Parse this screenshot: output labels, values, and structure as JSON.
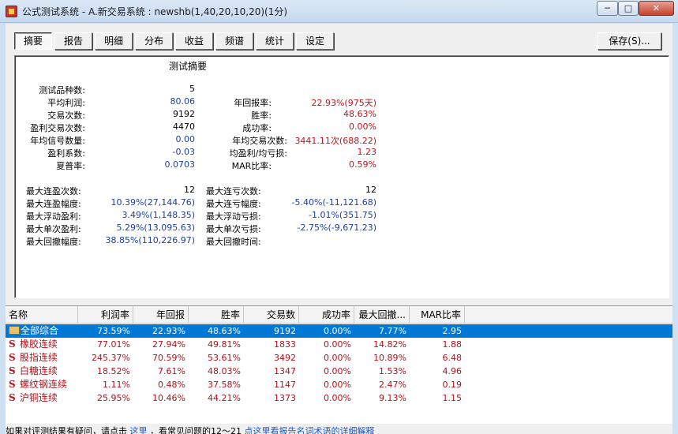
{
  "window": {
    "title": "公式测试系统 - A.新交易系统 : newshb(1,40,20,10,20)(1分)",
    "min_label": "─",
    "max_label": "□",
    "close_label": "✕"
  },
  "tabs": [
    "摘要",
    "报告",
    "明细",
    "分布",
    "收益",
    "频谱",
    "统计",
    "设定"
  ],
  "active_tab": "摘要",
  "save_label": "保存(S)...",
  "summary": {
    "title": "测试摘要",
    "left_block": [
      {
        "label": "测试品种数:",
        "value": "5"
      },
      {
        "label": "平均利润:",
        "value": "80.06"
      },
      {
        "label": "交易次数:",
        "value": "9192"
      },
      {
        "label": "盈利交易次数:",
        "value": "4470"
      },
      {
        "label": "年均信号数量:",
        "value": "0.00"
      },
      {
        "label": "盈利系数:",
        "value": "-0.03"
      },
      {
        "label": "夏普率:",
        "value": "0.0703"
      }
    ],
    "right_block": [
      {
        "label": "年回报率:",
        "value": "22.93%(975天)"
      },
      {
        "label": "胜率:",
        "value": "48.63%"
      },
      {
        "label": "成功率:",
        "value": "0.00%"
      },
      {
        "label": "年均交易次数:",
        "value": "3441.11次(688.22)"
      },
      {
        "label": "均盈利/均亏损:",
        "value": "1.23"
      },
      {
        "label": "MAR比率:",
        "value": "0.59%"
      }
    ],
    "left_block2": [
      {
        "label": "最大连盈次数:",
        "value": "12"
      },
      {
        "label": "最大连盈幅度:",
        "value": "10.39%(27,144.76)"
      },
      {
        "label": "最大浮动盈利:",
        "value": "3.49%(1,148.35)"
      },
      {
        "label": "最大单次盈利:",
        "value": "5.29%(13,095.63)"
      },
      {
        "label": "最大回撤幅度:",
        "value": "38.85%(110,226.97)"
      }
    ],
    "right_block2": [
      {
        "label": "最大连亏次数:",
        "value": "12"
      },
      {
        "label": "最大连亏幅度:",
        "value": "-5.40%(-11,121.68)"
      },
      {
        "label": "最大浮动亏损:",
        "value": "-1.01%(351.75)"
      },
      {
        "label": "最大单次亏损:",
        "value": "-2.75%(-9,671.23)"
      },
      {
        "label": "最大回撤时间:",
        "value": ""
      }
    ]
  },
  "table": {
    "columns": [
      "名称",
      "利润率",
      "年回报",
      "胜率",
      "交易数",
      "成功率",
      "最大回撤...",
      "MAR比率"
    ],
    "rows": [
      {
        "marker": "folder-icon",
        "name": "全部综合",
        "cells": [
          "73.59%",
          "22.93%",
          "48.63%",
          "9192",
          "0.00%",
          "7.77%",
          "2.95"
        ]
      },
      {
        "marker": "S",
        "name": "橡胶连续",
        "cells": [
          "77.01%",
          "27.94%",
          "49.81%",
          "1833",
          "0.00%",
          "14.82%",
          "1.88"
        ]
      },
      {
        "marker": "S",
        "name": "股指连续",
        "cells": [
          "245.37%",
          "70.59%",
          "53.61%",
          "3492",
          "0.00%",
          "10.89%",
          "6.48"
        ]
      },
      {
        "marker": "S",
        "name": "白糖连续",
        "cells": [
          "18.52%",
          "7.61%",
          "48.03%",
          "1347",
          "0.00%",
          "1.53%",
          "4.96"
        ]
      },
      {
        "marker": "S",
        "name": "螺纹钢连续",
        "cells": [
          "1.11%",
          "0.48%",
          "37.58%",
          "1147",
          "0.00%",
          "2.47%",
          "0.19"
        ]
      },
      {
        "marker": "S",
        "name": "沪铜连续",
        "cells": [
          "25.95%",
          "10.46%",
          "44.21%",
          "1373",
          "0.00%",
          "9.13%",
          "1.15"
        ]
      }
    ]
  },
  "footer": {
    "text1": "如果对评测结果有疑问，请点击",
    "link1": "这里",
    "text2": "，看常见问题的12～21",
    "link2": "点这里看报告名词术语的详细解释"
  }
}
